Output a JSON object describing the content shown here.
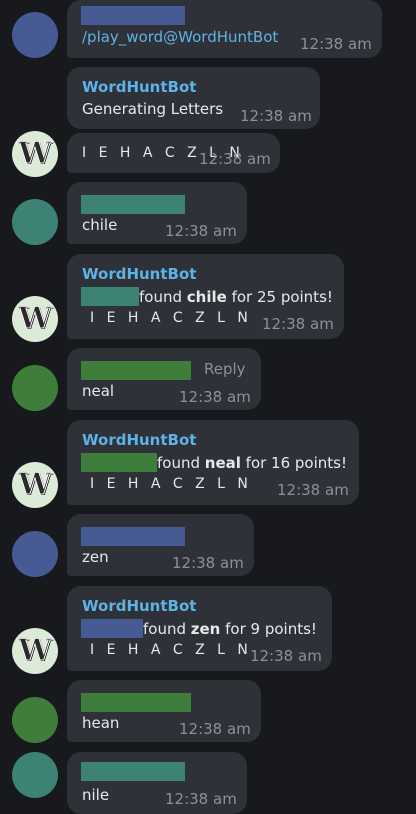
{
  "colors": {
    "background": "#17191c",
    "bubble": "#2e3238",
    "sender": "#5fb2e4",
    "time": "#8c9197",
    "user_blue": "#465a94",
    "user_teal": "#3d8375",
    "user_green": "#3f7e3a",
    "bot_avatar_bg": "#dcebd8"
  },
  "bot_avatar_letter": "W",
  "messages": {
    "m1": {
      "text": "/play_word@WordHuntBot",
      "time": "12:38 am"
    },
    "m2": {
      "sender": "WordHuntBot",
      "text": "Generating Letters",
      "time": "12:38 am"
    },
    "m3": {
      "letters": "I E H A C Z L N",
      "time": "12:38 am"
    },
    "m4": {
      "text": "chile",
      "time": "12:38 am"
    },
    "m5": {
      "sender": "WordHuntBot",
      "pre": "found ",
      "word": "chile",
      "post": " for 25 points!",
      "letters": "I E H A C Z L N",
      "time": "12:38 am"
    },
    "m6": {
      "reply": "Reply",
      "text": "neal",
      "time": "12:38 am"
    },
    "m7": {
      "sender": "WordHuntBot",
      "pre": "found ",
      "word": "neal",
      "post": " for 16 points!",
      "letters": "I E H A C Z L N",
      "time": "12:38 am"
    },
    "m8": {
      "text": "zen",
      "time": "12:38 am"
    },
    "m9": {
      "sender": "WordHuntBot",
      "pre": "found ",
      "word": "zen",
      "post": " for 9 points!",
      "letters": "I E H A C Z L N",
      "time": "12:38 am"
    },
    "m10": {
      "text": "hean",
      "time": "12:38 am"
    },
    "m11": {
      "text": "nile",
      "time": "12:38 am"
    }
  }
}
